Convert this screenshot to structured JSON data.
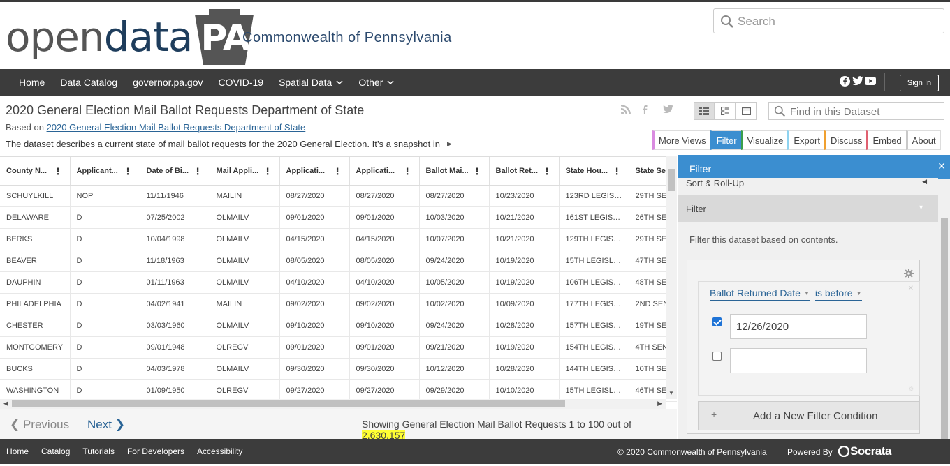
{
  "header": {
    "logo_open": "open",
    "logo_data": "data",
    "logo_pa": "PA",
    "subtitle": "Commonwealth of Pennsylvania",
    "search_placeholder": "Search"
  },
  "nav": {
    "items": [
      {
        "label": "Home"
      },
      {
        "label": "Data Catalog"
      },
      {
        "label": "governor.pa.gov"
      },
      {
        "label": "COVID-19"
      },
      {
        "label": "Spatial Data",
        "dropdown": true
      },
      {
        "label": "Other",
        "dropdown": true
      }
    ],
    "signin": "Sign In",
    "social": [
      "facebook-icon",
      "twitter-icon",
      "youtube-icon"
    ]
  },
  "dataset": {
    "title": "2020 General Election Mail Ballot Requests Department of State",
    "based_on_prefix": "Based on",
    "based_on_link": "2020 General Election Mail Ballot Requests Department of State",
    "description": "The dataset describes a current state of mail ballot requests for the 2020 General Election. It’s a snapshot in",
    "find_placeholder": "Find in this Dataset",
    "tabs": [
      {
        "label": "More Views",
        "color": "#d98be0"
      },
      {
        "label": "Filter",
        "color": "#3b8ed0",
        "active": true
      },
      {
        "label": "Visualize",
        "color": "#3a9e4a"
      },
      {
        "label": "Export",
        "color": "#8fd3f0"
      },
      {
        "label": "Discuss",
        "color": "#f0a030"
      },
      {
        "label": "Embed",
        "color": "#e06070"
      },
      {
        "label": "About",
        "color": "#c9c9c9"
      }
    ]
  },
  "grid": {
    "columns": [
      "County N...",
      "Applicant...",
      "Date of Bi...",
      "Mail Appli...",
      "Applicati...",
      "Applicati...",
      "Ballot Mai...",
      "Ballot Ret...",
      "State Hou...",
      "State Se..."
    ],
    "rows": [
      [
        "SCHUYLKILL",
        "NOP",
        "11/11/1946",
        "MAILIN",
        "08/27/2020",
        "08/27/2020",
        "08/27/2020",
        "10/23/2020",
        "123RD LEGISL...",
        "29TH SEN"
      ],
      [
        "DELAWARE",
        "D",
        "07/25/2002",
        "OLMAILV",
        "09/01/2020",
        "09/01/2020",
        "10/03/2020",
        "10/21/2020",
        "161ST LEGISL...",
        "26TH SEN"
      ],
      [
        "BERKS",
        "D",
        "10/04/1998",
        "OLMAILV",
        "04/15/2020",
        "04/15/2020",
        "10/07/2020",
        "10/21/2020",
        "129TH LEGISL...",
        "29TH SEN"
      ],
      [
        "BEAVER",
        "D",
        "11/18/1963",
        "OLMAILV",
        "08/05/2020",
        "08/05/2020",
        "09/24/2020",
        "10/19/2020",
        "15TH LEGISLA...",
        "47TH SEN"
      ],
      [
        "DAUPHIN",
        "D",
        "01/11/1963",
        "OLMAILV",
        "04/10/2020",
        "04/10/2020",
        "10/05/2020",
        "10/19/2020",
        "106TH LEGISL...",
        "48TH SEN"
      ],
      [
        "PHILADELPHIA",
        "D",
        "04/02/1941",
        "MAILIN",
        "09/02/2020",
        "09/02/2020",
        "10/02/2020",
        "10/09/2020",
        "177TH LEGISL...",
        "2ND SEN"
      ],
      [
        "CHESTER",
        "D",
        "03/03/1960",
        "OLMAILV",
        "09/10/2020",
        "09/10/2020",
        "09/24/2020",
        "10/28/2020",
        "157TH LEGISL...",
        "19TH SEN"
      ],
      [
        "MONTGOMERY",
        "D",
        "09/01/1948",
        "OLREGV",
        "09/01/2020",
        "09/01/2020",
        "09/21/2020",
        "10/19/2020",
        "154TH LEGISL...",
        "4TH SEN"
      ],
      [
        "BUCKS",
        "D",
        "04/03/1978",
        "OLMAILV",
        "09/30/2020",
        "09/30/2020",
        "10/12/2020",
        "10/28/2020",
        "144TH LEGISL...",
        "10TH SEN"
      ],
      [
        "WASHINGTON",
        "D",
        "01/09/1950",
        "OLREGV",
        "09/27/2020",
        "09/27/2020",
        "09/29/2020",
        "10/10/2020",
        "15TH LEGISLA...",
        "46TH SEN"
      ]
    ]
  },
  "pager": {
    "prev": "Previous",
    "next": "Next",
    "showing": "Showing General Election Mail Ballot Requests 1 to 100 out of",
    "total": "2,630,157"
  },
  "filter_panel": {
    "title": "Filter",
    "rollup": "Sort & Roll-Up",
    "section": "Filter",
    "description": "Filter this dataset based on contents.",
    "column": "Ballot Returned Date",
    "operator": "is before",
    "value1": "12/26/2020",
    "value2": "",
    "add_condition": "Add a New Filter Condition"
  },
  "footer": {
    "links": [
      "Home",
      "Catalog",
      "Tutorials",
      "For Developers",
      "Accessibility"
    ],
    "copyright": "© 2020 Commonwealth of Pennsylvania",
    "powered_by": "Powered By",
    "brand": "Socrata"
  }
}
